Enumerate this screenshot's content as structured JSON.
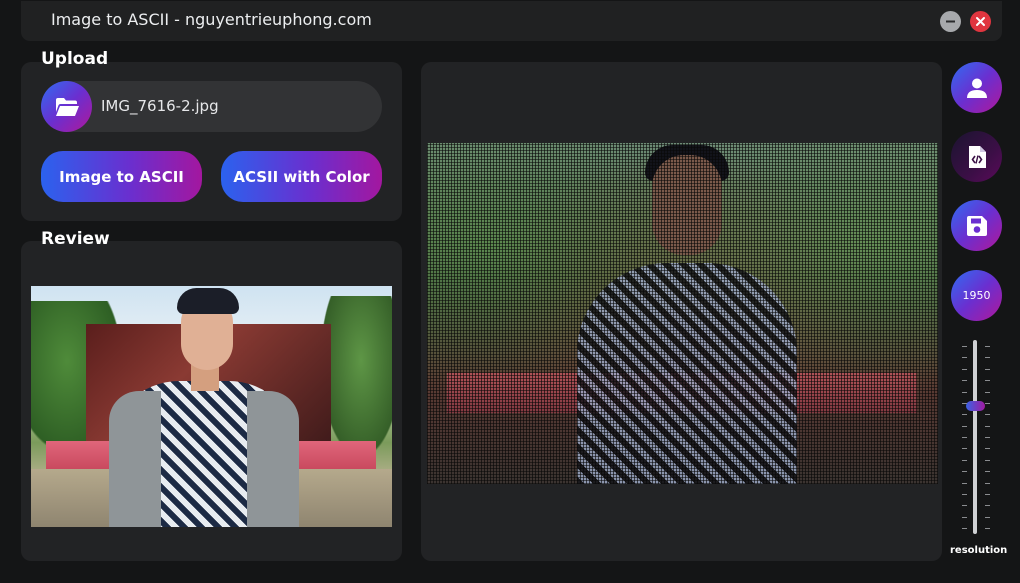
{
  "window": {
    "title": "Image to ASCII - nguyentrieuphong.com",
    "controls": [
      "minimize-icon",
      "close-icon"
    ]
  },
  "upload": {
    "heading": "Upload",
    "file_name": "IMG_7616-2.jpg",
    "folder_icon": "folder-open-icon",
    "buttons": {
      "image_to_ascii": "Image to ASCII",
      "ascii_with_color": "ACSII with Color"
    }
  },
  "review": {
    "heading": "Review"
  },
  "sidebar": {
    "icons": [
      "user-icon",
      "code-file-icon",
      "save-icon"
    ],
    "resolution_value": "1950",
    "slider_label": "resolution",
    "slider_level_fraction": 0.66
  },
  "colors": {
    "gradient_start": "#2b62ee",
    "gradient_mid": "#6a2fcf",
    "gradient_end": "#a3179f",
    "close_red": "#e0353f",
    "panel_bg": "#222325",
    "app_bg": "#141516"
  }
}
